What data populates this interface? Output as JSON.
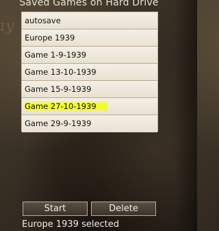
{
  "panel": {
    "title": "Saved Games on Hard Drive"
  },
  "saves": [
    {
      "label": "autosave"
    },
    {
      "label": "Europe 1939"
    },
    {
      "label": "Game 1-9-1939"
    },
    {
      "label": "Game 13-10-1939"
    },
    {
      "label": "Game 15-9-1939"
    },
    {
      "label": "Game 27-10-1939",
      "highlighted": true
    },
    {
      "label": "Game 29-9-1939"
    }
  ],
  "buttons": {
    "start": "Start",
    "delete": "Delete"
  },
  "status": "Europe 1939 selected",
  "colors": {
    "highlight": "#f3fa23",
    "list_background": "#efe9dc",
    "button_background": "#4a4137"
  }
}
